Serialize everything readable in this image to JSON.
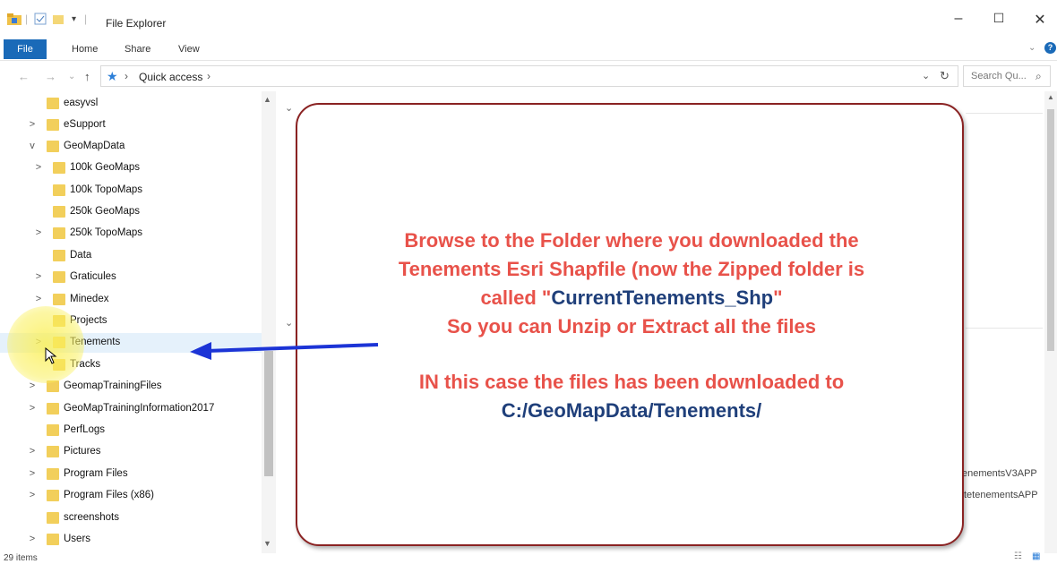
{
  "window": {
    "title": "File Explorer"
  },
  "ribbon": {
    "tabs": [
      "File",
      "Home",
      "Share",
      "View"
    ]
  },
  "address": {
    "path": "Quick access",
    "search_placeholder": "Search Qu..."
  },
  "tree": [
    {
      "label": "easyvsl",
      "indent": 0,
      "expander": ""
    },
    {
      "label": "eSupport",
      "indent": 0,
      "expander": ">"
    },
    {
      "label": "GeoMapData",
      "indent": 0,
      "expander": "v"
    },
    {
      "label": "100k GeoMaps",
      "indent": 1,
      "expander": ">"
    },
    {
      "label": "100k TopoMaps",
      "indent": 1,
      "expander": ""
    },
    {
      "label": "250k GeoMaps",
      "indent": 1,
      "expander": ""
    },
    {
      "label": "250k TopoMaps",
      "indent": 1,
      "expander": ">"
    },
    {
      "label": "Data",
      "indent": 1,
      "expander": ""
    },
    {
      "label": "Graticules",
      "indent": 1,
      "expander": ">"
    },
    {
      "label": "Minedex",
      "indent": 1,
      "expander": ">"
    },
    {
      "label": "Projects",
      "indent": 1,
      "expander": ""
    },
    {
      "label": "Tenements",
      "indent": 1,
      "expander": ">",
      "selected": true
    },
    {
      "label": "Tracks",
      "indent": 1,
      "expander": ""
    },
    {
      "label": "GeomapTrainingFiles",
      "indent": 0,
      "expander": ">"
    },
    {
      "label": "GeoMapTrainingInformation2017",
      "indent": 0,
      "expander": ">"
    },
    {
      "label": "PerfLogs",
      "indent": 0,
      "expander": ""
    },
    {
      "label": "Pictures",
      "indent": 0,
      "expander": ">"
    },
    {
      "label": "Program Files",
      "indent": 0,
      "expander": ">"
    },
    {
      "label": "Program Files (x86)",
      "indent": 0,
      "expander": ">"
    },
    {
      "label": "screenshots",
      "indent": 0,
      "expander": ""
    },
    {
      "label": "Users",
      "indent": 0,
      "expander": ">"
    }
  ],
  "content": {
    "partial_file_1": "enementsV3APP",
    "partial_file_2": "tetenementsAPP"
  },
  "status": {
    "items": "29 items"
  },
  "callout": {
    "line1": "Browse to the Folder where you downloaded the",
    "line2": "Tenements Esri Shapfile (now the Zipped folder is",
    "line3_prefix": "called \"",
    "line3_name": "CurrentTenements_Shp",
    "line3_suffix": "\"",
    "line4": "So you can Unzip or Extract all the files",
    "line5": "IN this case the files has been downloaded to",
    "line6": "C:/GeoMapData/Tenements/"
  },
  "colors": {
    "callout_red": "#e8524a",
    "callout_blue": "#1f3f7a",
    "arrow": "#1c34d6",
    "file_tab": "#1a6ab8"
  }
}
